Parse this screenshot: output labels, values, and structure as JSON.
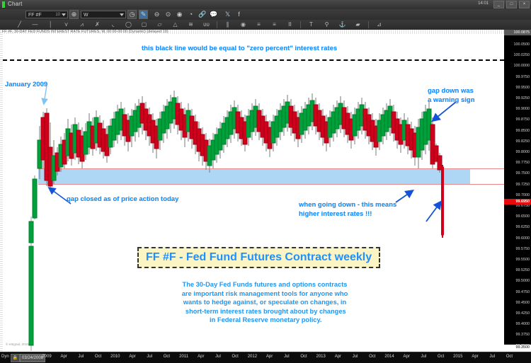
{
  "window": {
    "title": "Chart",
    "min_label": "_",
    "max_label": "□",
    "close_label": "×",
    "right_status": "14:01"
  },
  "symbol_bar": {
    "symbol": "FF #F",
    "symbol_sub": "10",
    "interval": "W",
    "icons": [
      "magnifier-icon",
      "clock-icon",
      "pencil-icon",
      "zoom-out-icon",
      "target-icon",
      "clock-alt-icon",
      "link-icon",
      "comment-icon",
      "twitter-icon",
      "facebook-icon"
    ]
  },
  "draw_tools": [
    "trendline-icon",
    "horizontal-line-icon",
    "vertical-line-icon",
    "polyline-icon",
    "fib-retracement-icon",
    "fib-fan-icon",
    "fib-arc-icon",
    "ellipse-icon",
    "rectangle-icon",
    "parallelogram-icon",
    "triangle-icon",
    "pitchfork-icon",
    "cycles-icon",
    "parallel-channel-icon",
    "gann-icon",
    "text-lines-icon",
    "text-list-icon",
    "bars-icon",
    "text-icon",
    "balloon-icon",
    "anchor-icon",
    "fill-icon",
    "measure-icon"
  ],
  "chart": {
    "subtitle": "FF #F, 30-DAY FED FUNDS INTEREST RATE FUTURES, W, 00:00-00:00 (Dynamic) (delayed 10)",
    "watermark": "© eSignal, 2015"
  },
  "annotations": {
    "zero_line": "this black line would be equal to \"zero percent\" interest rates",
    "january_2009": "January 2009",
    "gap_down": "gap down was\na warning sign",
    "gap_closed": "gap closed as of price action today",
    "going_down": "when going down - this means\nhigher interest rates !!!",
    "title_box": "FF #F - Fed Fund Futures Contract weekly",
    "paragraph": "The 30-Day Fed Funds futures and options contracts\nare important risk management tools for anyone who\nwants to hedge against, or speculate on changes, in\n short-term interest rates brought about by changes\n in Federal Reserve monetary policy."
  },
  "price_axis": {
    "top_value": "100.0875",
    "last_value": "99.6950",
    "ticks": [
      "100.0500",
      "100.0250",
      "100.0000",
      "99.9750",
      "99.9500",
      "99.9250",
      "99.9000",
      "99.8750",
      "99.8500",
      "99.8250",
      "99.8000",
      "99.7750",
      "99.7500",
      "99.7250",
      "99.7000",
      "99.6750",
      "99.6500",
      "99.6250",
      "99.6000",
      "99.5750",
      "99.5500",
      "99.5250",
      "99.5000",
      "99.4750",
      "99.4500",
      "99.4250",
      "99.4000",
      "99.3750",
      "99.3500"
    ]
  },
  "time_axis": {
    "dyn_label": "Dyn",
    "lock_icon": "lock-icon",
    "date_value": "03/24/2008",
    "last_price_tag": "99.3500",
    "ticks": [
      "2009",
      "Apr",
      "Jul",
      "Oct",
      "2010",
      "Apr",
      "Jul",
      "Oct",
      "2011",
      "Apr",
      "Jul",
      "Oct",
      "2012",
      "Apr",
      "Jul",
      "Oct",
      "2013",
      "Apr",
      "Jul",
      "Oct",
      "2014",
      "Apr",
      "Jul",
      "Oct",
      "2015",
      "Apr",
      "Jul",
      "Oct"
    ]
  },
  "chart_data": {
    "type": "line",
    "title": "FF #F - Fed Fund Futures Contract weekly",
    "subtitle": "FF #F, 30-DAY FED FUNDS INTEREST RATE FUTURES, W, 00:00-00:00 (Dynamic) (delayed 10)",
    "xlabel": "",
    "ylabel": "",
    "ylim": [
      99.35,
      100.0875
    ],
    "xlim": [
      "2008-03-24",
      "2015-12-31"
    ],
    "grid": false,
    "legend": "none",
    "zero_percent_line": 100.0,
    "support_band": [
      99.7,
      99.75
    ],
    "last_price": 99.695,
    "series": [
      {
        "name": "FF #F weekly candles",
        "type": "candlestick",
        "up_color": "#00a13a",
        "down_color": "#d0021b",
        "note": "weekly OHLC candles from 2008 through late 2015"
      }
    ],
    "annotations": [
      {
        "text": "this black line would be equal to \"zero percent\" interest rates",
        "y": 100.0
      },
      {
        "text": "January 2009",
        "x": "2009-01",
        "y": 99.96
      },
      {
        "text": "gap closed as of price action today",
        "x": "2009-01",
        "y": 99.72
      },
      {
        "text": "gap down was a warning sign",
        "x": "2015-09",
        "y": 99.93
      },
      {
        "text": "when going down - this means higher interest rates !!!",
        "x": "2015-10",
        "y": 99.6
      }
    ]
  }
}
